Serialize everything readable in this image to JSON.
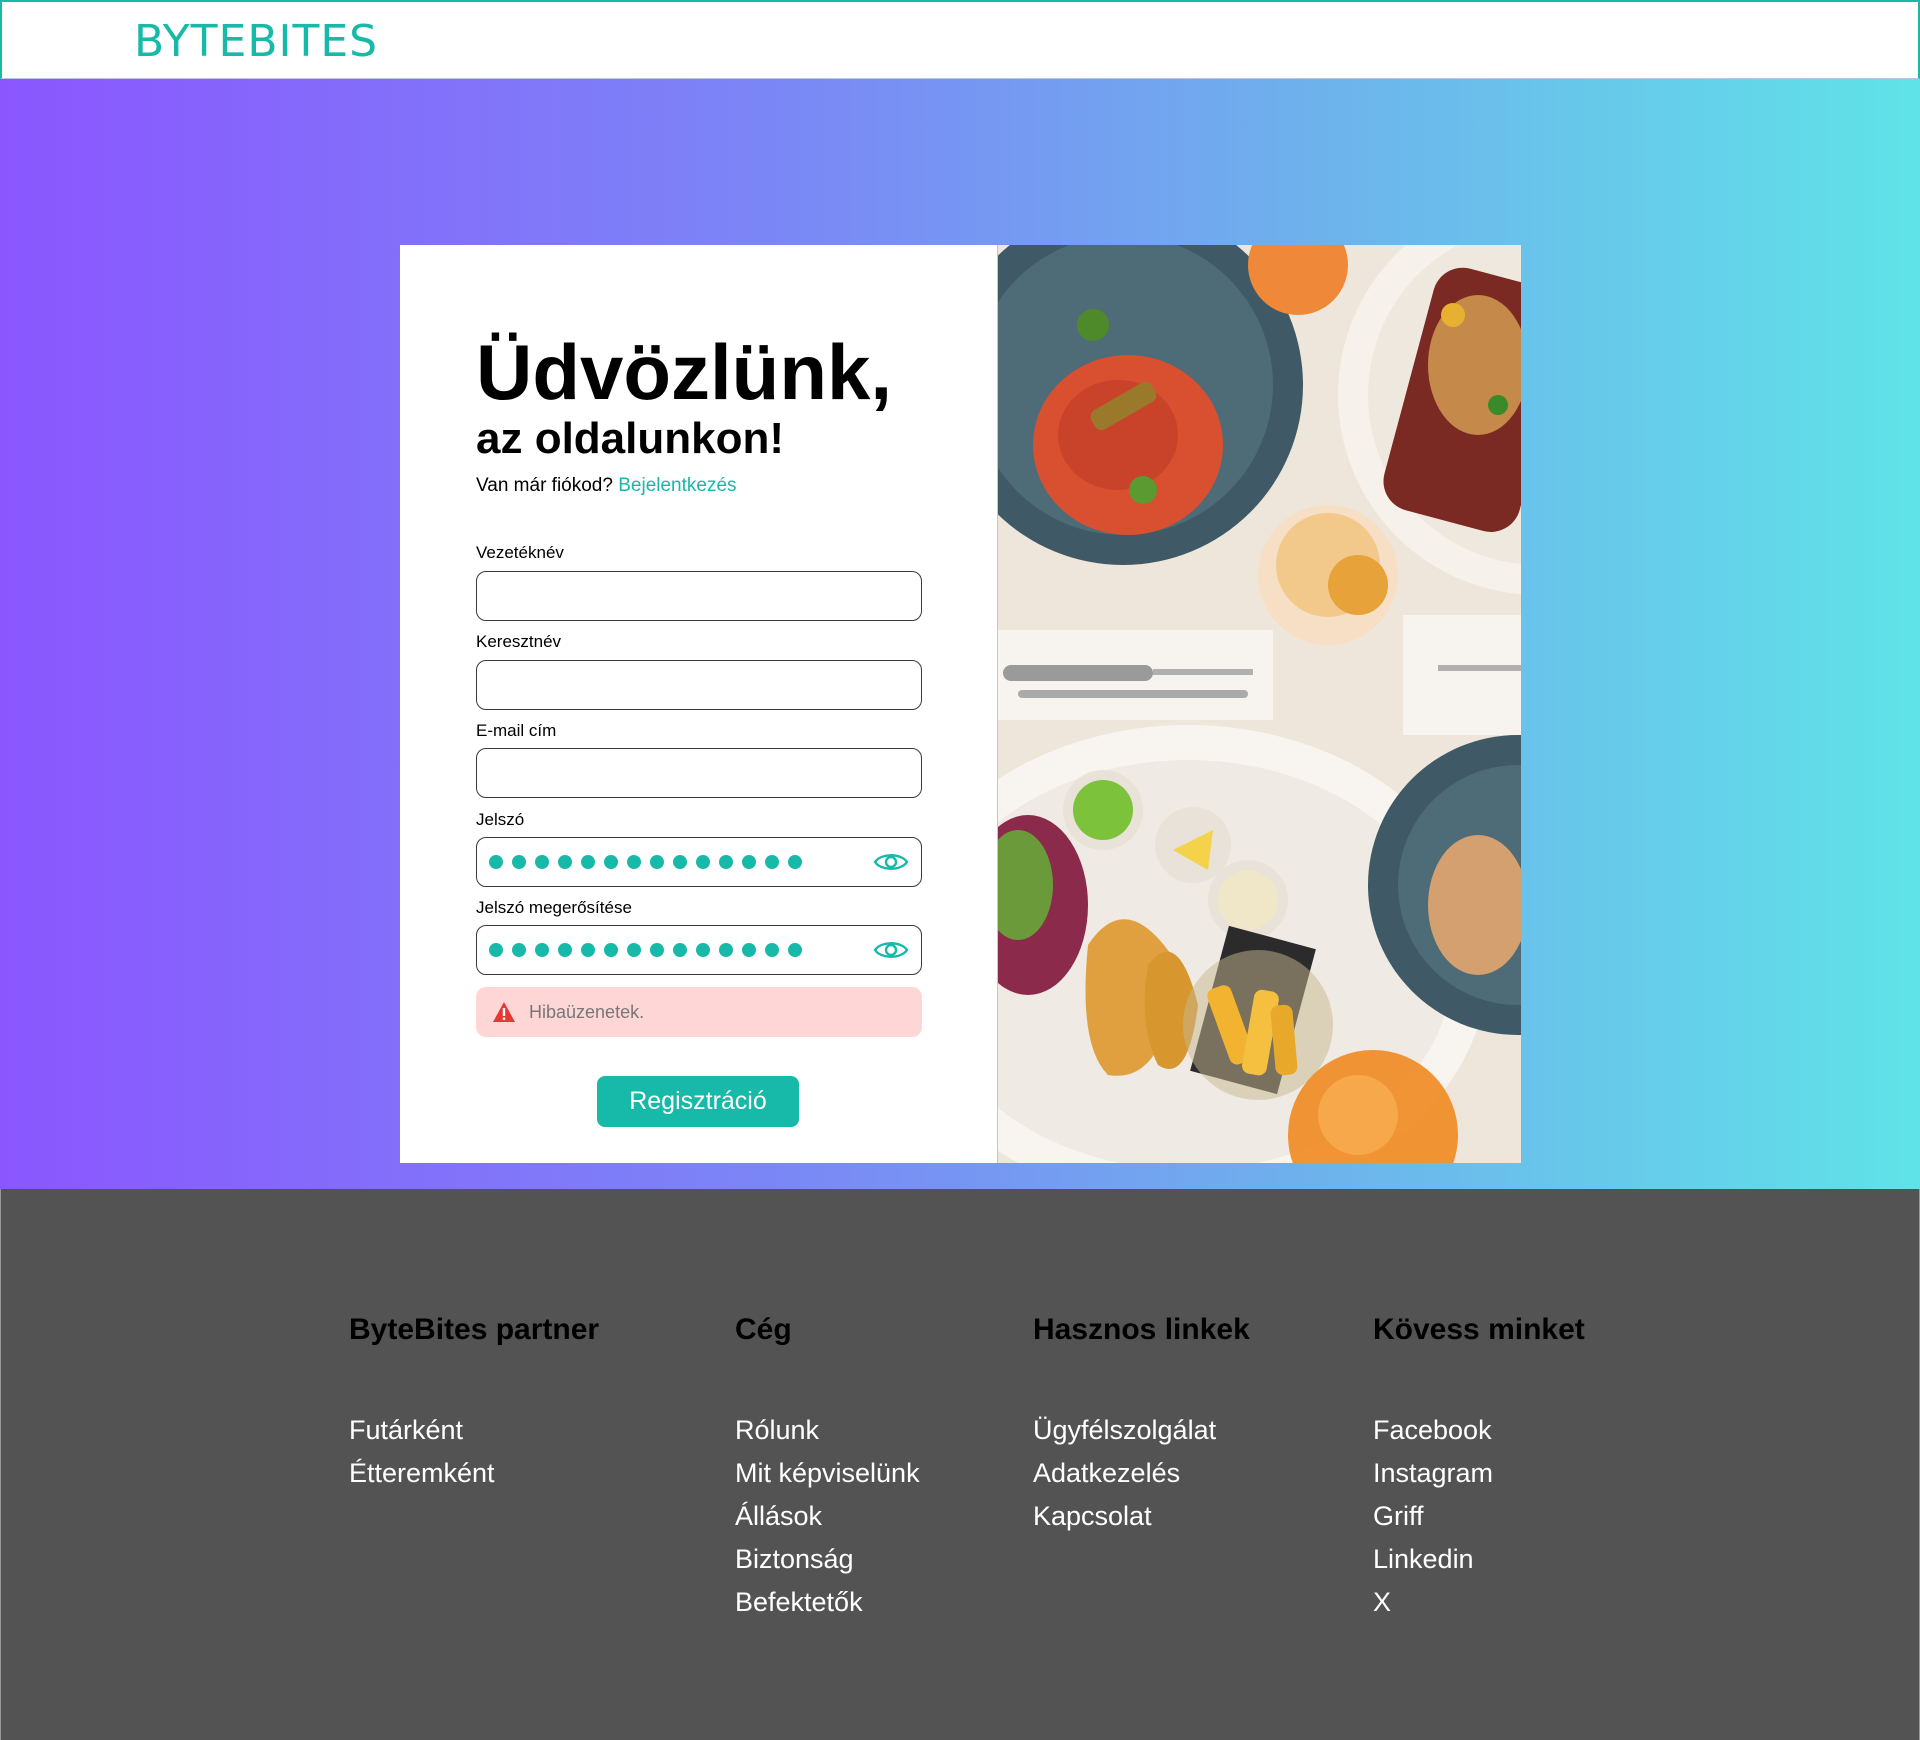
{
  "header": {
    "logo": "BYTEBITES"
  },
  "form": {
    "title_line1": "Üdvözlünk,",
    "title_line2": "az oldalunkon!",
    "have_account_text": "Van már fiókod?",
    "login_link": "Bejelentkezés",
    "fields": [
      {
        "label": "Vezetéknév",
        "value": ""
      },
      {
        "label": "Keresztnév",
        "value": ""
      },
      {
        "label": "E-mail cím",
        "value": ""
      },
      {
        "label": "Jelszó",
        "value": "••••••••••••••"
      },
      {
        "label": "Jelszó megerősítése",
        "value": "••••••••••••••"
      }
    ],
    "error_message": "Hibaüzenetek.",
    "submit_label": "Regisztráció"
  },
  "footer": {
    "columns": [
      {
        "title": "ByteBites partner",
        "links": [
          "Futárként",
          "Étteremként"
        ]
      },
      {
        "title": "Cég",
        "links": [
          "Rólunk",
          "Mit képviselünk",
          "Állások",
          "Biztonság",
          "Befektetők"
        ]
      },
      {
        "title": "Hasznos linkek",
        "links": [
          "Ügyfélszolgálat",
          "Adatkezelés",
          "Kapcsolat"
        ]
      },
      {
        "title": "Kövess minket",
        "links": [
          "Facebook",
          "Instagram",
          "Griff",
          "Linkedin",
          "X"
        ]
      }
    ]
  },
  "colors": {
    "accent": "#17b9a8",
    "gradient_start": "#8b56ff",
    "gradient_end": "#5fe3e8",
    "footer_bg": "#535353",
    "error_bg": "#ffd6d6"
  },
  "icons": [
    "eye-icon",
    "warning-icon"
  ]
}
